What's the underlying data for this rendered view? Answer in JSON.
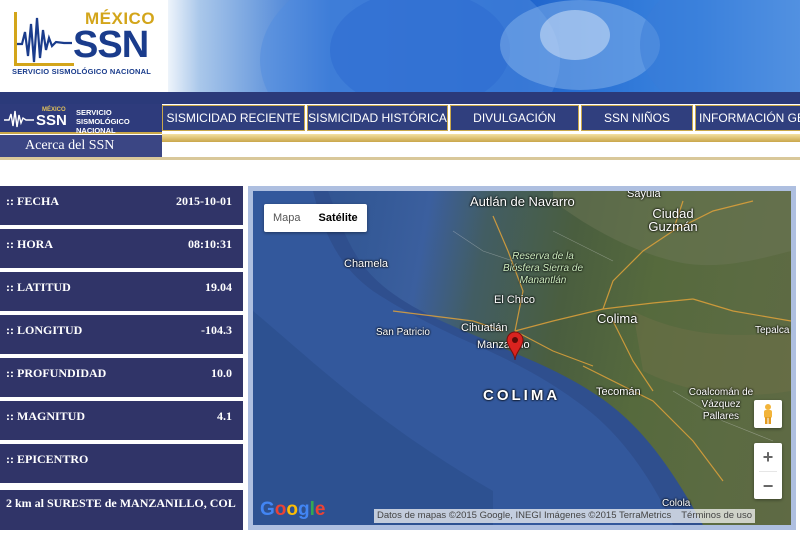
{
  "header": {
    "logo_country": "MÉXICO",
    "logo_acronym": "SSN",
    "logo_subtitle": "SERVICIO SISMOLÓGICO NACIONAL"
  },
  "nav": {
    "logo_country": "MÉXICO",
    "logo_acronym": "SSN",
    "logo_text_line1": "SERVICIO",
    "logo_text_line2": "SISMOLÓGICO",
    "logo_text_line3": "NACIONAL",
    "about": "Acerca del SSN",
    "items": [
      {
        "label": "SISMICIDAD RECIENTE"
      },
      {
        "label": "SISMICIDAD HISTÓRICA"
      },
      {
        "label": "DIVULGACIÓN"
      },
      {
        "label": "SSN NIÑOS"
      },
      {
        "label": "INFORMACIÓN GENERAL"
      }
    ]
  },
  "quake": {
    "rows": [
      {
        "label": ":: FECHA",
        "value": "2015-10-01"
      },
      {
        "label": ":: HORA",
        "value": "08:10:31"
      },
      {
        "label": ":: LATITUD",
        "value": "19.04"
      },
      {
        "label": ":: LONGITUD",
        "value": "-104.3"
      },
      {
        "label": ":: PROFUNDIDAD",
        "value": "10.0"
      },
      {
        "label": ":: MAGNITUD",
        "value": "4.1"
      },
      {
        "label": ":: EPICENTRO",
        "value": ""
      }
    ],
    "epicenter_text": "2 km al SURESTE de MANZANILLO, COL"
  },
  "map": {
    "type_map": "Mapa",
    "type_satellite": "Satélite",
    "places": {
      "autlan": "Autlán de Navarro",
      "sayula": "Sayula",
      "guzman": "Ciudad Guzmán",
      "chamela": "Chamela",
      "reserva": "Reserva de la Biósfera Sierra de Manantlán",
      "el_chico": "El Chico",
      "san_patricio": "San Patricio",
      "cihuatlan": "Cihuatlán",
      "manzanillo": "Manzanillo",
      "colima_city": "Colima",
      "tepalca": "Tepalca",
      "colima_state": "COLIMA",
      "tecoman": "Tecomán",
      "coalcoman": "Coalcomán de Vázquez Pallares",
      "colola": "Colola"
    },
    "zoom_in": "+",
    "zoom_out": "−",
    "google": "Google",
    "attribution": "Datos de mapas ©2015 Google, INEGI Imágenes ©2015 TerraMetrics",
    "terms": "Términos de uso",
    "colors": {
      "marker": "#d9231f",
      "marker_dot": "#5a0b08"
    }
  }
}
